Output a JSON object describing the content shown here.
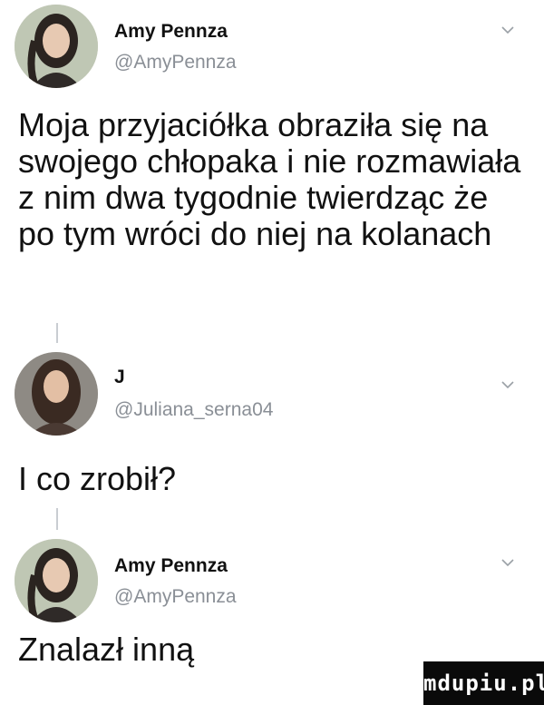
{
  "tweets": [
    {
      "author": "Amy Pennza",
      "handle": "@AmyPennza",
      "text": "Moja przyjaciółka obraziła się na swojego chłopaka i nie rozmawiała z nim dwa tygodnie twierdząc że po tym wróci do niej na kolanach",
      "avatar_icon": "woman-dark-hair-avatar",
      "menu_icon": "chevron-down-icon"
    },
    {
      "author": "J",
      "handle": "@Juliana_serna04",
      "text": "I co zrobił?",
      "avatar_icon": "woman-long-hair-avatar",
      "menu_icon": "chevron-down-icon"
    },
    {
      "author": "Amy Pennza",
      "handle": "@AmyPennza",
      "text": "Znalazł inną",
      "avatar_icon": "woman-dark-hair-avatar",
      "menu_icon": "chevron-down-icon"
    }
  ],
  "watermark": "mdupiu.pl",
  "colors": {
    "handle": "#8a8f96",
    "thread_line": "#c9cdd2",
    "watermark_bg": "#0a0a0a"
  }
}
